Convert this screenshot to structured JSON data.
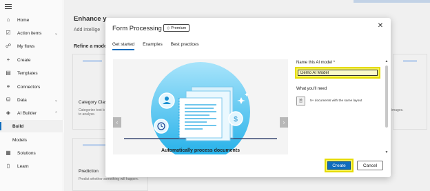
{
  "sidebar": {
    "items": [
      {
        "label": "Home",
        "icon": "home-icon"
      },
      {
        "label": "Action items",
        "icon": "checklist-icon",
        "chevron": "⌄"
      },
      {
        "label": "My flows",
        "icon": "flow-icon"
      },
      {
        "label": "Create",
        "icon": "plus-icon"
      },
      {
        "label": "Templates",
        "icon": "template-icon"
      },
      {
        "label": "Connectors",
        "icon": "connector-icon"
      },
      {
        "label": "Data",
        "icon": "database-icon",
        "chevron": "⌄"
      },
      {
        "label": "AI Builder",
        "icon": "ai-builder-icon",
        "chevron": "⌃"
      },
      {
        "label": "Build",
        "icon": ""
      },
      {
        "label": "Models",
        "icon": ""
      },
      {
        "label": "Solutions",
        "icon": "solutions-icon"
      },
      {
        "label": "Learn",
        "icon": "book-icon"
      }
    ]
  },
  "background": {
    "title": "Enhance y",
    "subtitle": "Add intellige",
    "refine": "Refine a mode",
    "cards": [
      {
        "title": "Category Clas",
        "desc": "Categorize text b\nto analyze."
      },
      {
        "title": "Prediction",
        "desc": "Predict whether something will happen."
      }
    ],
    "right_text": "images."
  },
  "modal": {
    "title": "Form Processing",
    "badge": "Premium",
    "close": "✕",
    "tabs": [
      "Get started",
      "Examples",
      "Best practices"
    ],
    "caption": "Automatically process documents",
    "name_label": "Name this AI model *",
    "name_value": "Demo AI Model",
    "need_label": "What you'll need",
    "need_item": "5+ documents with the same layout",
    "create": "Create",
    "cancel": "Cancel"
  },
  "colors": {
    "accent": "#0f6cbd",
    "highlight": "#f5f25a",
    "illustration": "#4fc3f7"
  }
}
